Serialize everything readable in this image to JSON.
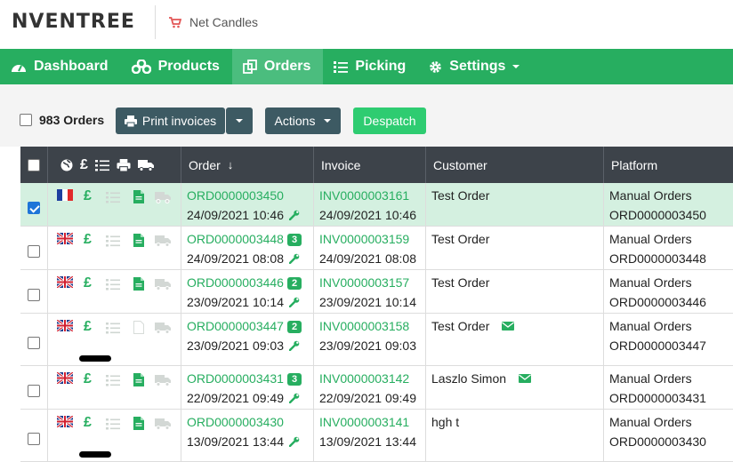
{
  "app": {
    "logo": "NVENTREE",
    "store_name": "Net Candles"
  },
  "nav": [
    {
      "label": "Dashboard",
      "icon": "dashboard-icon"
    },
    {
      "label": "Products",
      "icon": "products-icon"
    },
    {
      "label": "Orders",
      "icon": "orders-icon",
      "active": true
    },
    {
      "label": "Picking",
      "icon": "picking-icon"
    },
    {
      "label": "Settings",
      "icon": "gear-icon",
      "dropdown": true
    }
  ],
  "toolbar": {
    "count_label": "983 Orders",
    "print_label": "Print invoices",
    "actions_label": "Actions",
    "despatch_label": "Despatch"
  },
  "table": {
    "columns": {
      "order": "Order",
      "invoice": "Invoice",
      "customer": "Customer",
      "platform": "Platform"
    },
    "header_icons": [
      "globe-icon",
      "pound-icon",
      "list-icon",
      "print-icon",
      "truck-icon"
    ],
    "pound": "£",
    "rows": [
      {
        "flag": "FR",
        "selected": true,
        "order": "ORD0000003450",
        "badge": "",
        "order_date": "24/09/2021 10:46",
        "invoice": "INV0000003161",
        "invoice_date": "24/09/2021 10:46",
        "customer": "Test Order",
        "email": false,
        "platform": "Manual Orders",
        "platform_ref": "ORD0000003450",
        "doc": "active",
        "redact": false
      },
      {
        "flag": "UK",
        "selected": false,
        "order": "ORD0000003448",
        "badge": "3",
        "order_date": "24/09/2021 08:08",
        "invoice": "INV0000003159",
        "invoice_date": "24/09/2021 08:08",
        "customer": "Test Order",
        "email": false,
        "platform": "Manual Orders",
        "platform_ref": "ORD0000003448",
        "doc": "active",
        "redact": false
      },
      {
        "flag": "UK",
        "selected": false,
        "order": "ORD0000003446",
        "badge": "2",
        "order_date": "23/09/2021 10:14",
        "invoice": "INV0000003157",
        "invoice_date": "23/09/2021 10:14",
        "customer": "Test Order",
        "email": false,
        "platform": "Manual Orders",
        "platform_ref": "ORD0000003446",
        "doc": "active",
        "redact": false
      },
      {
        "flag": "UK",
        "selected": false,
        "order": "ORD0000003447",
        "badge": "2",
        "order_date": "23/09/2021 09:03",
        "invoice": "INV0000003158",
        "invoice_date": "23/09/2021 09:03",
        "customer": "Test Order",
        "email": true,
        "platform": "Manual Orders",
        "platform_ref": "ORD0000003447",
        "doc": "faded",
        "redact": true
      },
      {
        "flag": "UK",
        "selected": false,
        "order": "ORD0000003431",
        "badge": "3",
        "order_date": "22/09/2021 09:49",
        "invoice": "INV0000003142",
        "invoice_date": "22/09/2021 09:49",
        "customer": "Laszlo Simon",
        "email": true,
        "platform": "Manual Orders",
        "platform_ref": "ORD0000003431",
        "doc": "active",
        "redact": false
      },
      {
        "flag": "UK",
        "selected": false,
        "order": "ORD0000003430",
        "badge": "",
        "order_date": "13/09/2021 13:44",
        "invoice": "INV0000003141",
        "invoice_date": "13/09/2021 13:44",
        "customer": "hgh t",
        "email": false,
        "platform": "Manual Orders",
        "platform_ref": "ORD0000003430",
        "doc": "active",
        "redact": true
      }
    ]
  }
}
